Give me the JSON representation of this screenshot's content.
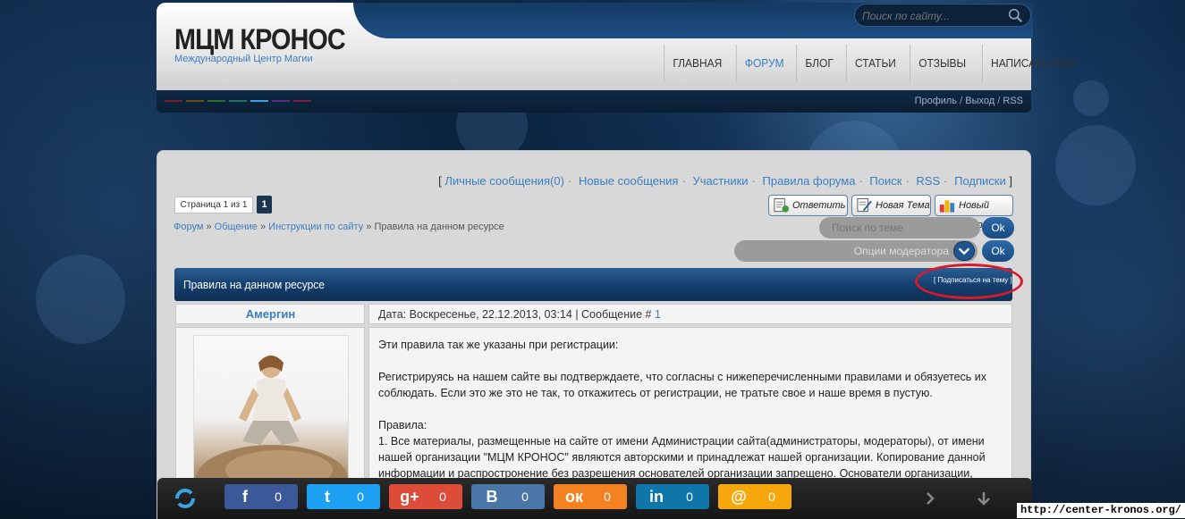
{
  "site": {
    "title": "МЦМ КРОНОС",
    "subtitle": "Международный Центр Магии",
    "search_placeholder": "Поиск по сайту..."
  },
  "nav": [
    "ГЛАВНАЯ",
    "ФОРУМ",
    "БЛОГ",
    "СТАТЬИ",
    "ОТЗЫВЫ",
    "НАПИСАТЬ НАМ"
  ],
  "nav_active": "ФОРУМ",
  "accent_colors": [
    "#7a1e2c",
    "#6a4a1a",
    "#2e6b2e",
    "#1e6f6a",
    "#3aa3e3",
    "#5a2d7a",
    "#7a1e4a"
  ],
  "user_links": {
    "profile": "Профиль",
    "logout": "Выход",
    "rss": "RSS",
    "sep": "/"
  },
  "forum_links": {
    "open": "[",
    "close": "]",
    "items": [
      "Личные сообщения(0)",
      "Новые сообщения",
      "Участники",
      "Правила форума",
      "Поиск",
      "RSS",
      "Подписки"
    ],
    "sep": "·"
  },
  "pager": {
    "label": "Страница 1 из 1",
    "current": "1"
  },
  "actions": {
    "reply": "Ответить",
    "new_topic": "Новая Тема",
    "new_poll": "Новый Опрос"
  },
  "breadcrumb": {
    "items": [
      "Форум",
      "Общение",
      "Инструкции по сайту"
    ],
    "current": "Правила на данном ресурсе",
    "sep": "»"
  },
  "topic_search": {
    "placeholder": "Поиск по теме",
    "ok": "Ok"
  },
  "moderator": {
    "label": "Опции модератора",
    "ok": "Ok"
  },
  "thread": {
    "title": "Правила на данном ресурсе",
    "subscribe": "[ Подписаться на тему ]"
  },
  "post": {
    "author": "Амергин",
    "meta_prefix": "Дата: Воскресенье, 22.12.2013, 03:14 | Сообщение #",
    "number": "1",
    "p1": "Эти правила так же указаны при регистрации:",
    "p2": "Регистрируясь на нашем сайте вы подтверждаете, что согласны с нижеперечисленными правилами и обязуетесь их соблюдать. Если это же это не так, то откажитесь от регистрации, не тратьте свое и наше время в пустую.",
    "p3_title": "Правила:",
    "p3_body": "1. Все материалы, размещенные на сайте от имени Администрации сайта(администраторы, модераторы), от имени нашей организации \"МЦМ КРОНОС\" являются авторскими и принадлежат нашей организации. Копирование данной информации и распростронение без разрешения основателей организации запрещено. Основатели организации,"
  },
  "share": [
    {
      "network": "facebook",
      "glyph": "f",
      "count": "0",
      "color": "#3b5998"
    },
    {
      "network": "twitter",
      "glyph": "t",
      "count": "0",
      "color": "#1da1f2"
    },
    {
      "network": "google-plus",
      "glyph": "g+",
      "count": "0",
      "color": "#dd4b39"
    },
    {
      "network": "vkontakte",
      "glyph": "B",
      "count": "0",
      "color": "#4a76a8"
    },
    {
      "network": "odnoklassniki",
      "glyph": "ок",
      "count": "0",
      "color": "#f58220"
    },
    {
      "network": "linkedin",
      "glyph": "in",
      "count": "0",
      "color": "#0e76a8"
    },
    {
      "network": "mail",
      "glyph": "@",
      "count": "0",
      "color": "#f5a70b"
    }
  ],
  "url_caption": "http://center-kronos.org/"
}
